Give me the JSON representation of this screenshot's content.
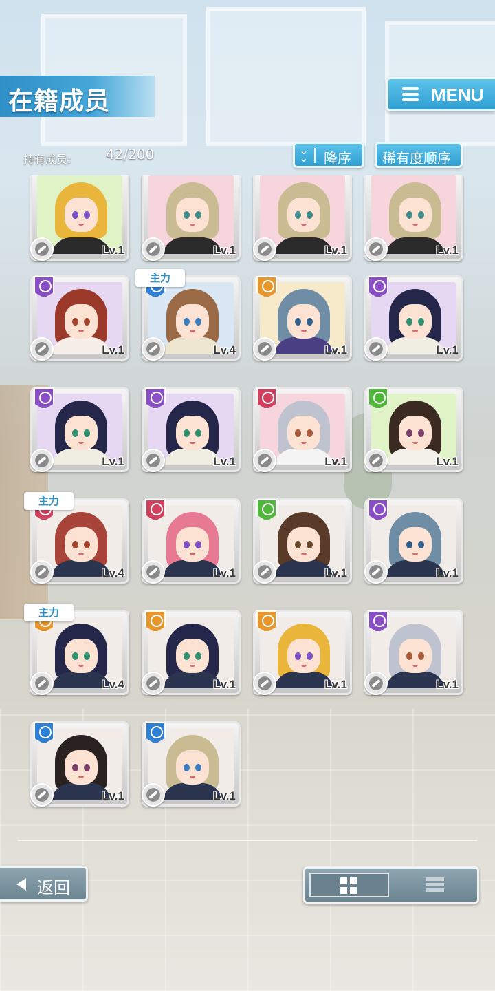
{
  "header": {
    "title": "在籍成员",
    "menu_label": "MENU"
  },
  "roster": {
    "count_label": "持有成员:",
    "count_value": "42/200"
  },
  "sort": {
    "order_label": "降序",
    "order_arrow": "⌄",
    "rarity_label": "稀有度顺序"
  },
  "badge_text": "主力",
  "cards": [
    {
      "level": "Lv.1",
      "attr": "green",
      "hair": "#e9b63b",
      "eye": "#7a4fc4",
      "body": "#2a2a2a",
      "bg": "#dff3c6",
      "badge": false,
      "top": true
    },
    {
      "level": "Lv.1",
      "attr": "red",
      "hair": "#c9bb92",
      "eye": "#3f8c8c",
      "body": "#2a2a2a",
      "bg": "#f6d6dc",
      "badge": false,
      "top": true
    },
    {
      "level": "Lv.1",
      "attr": "red",
      "hair": "#c9bb92",
      "eye": "#3f8c8c",
      "body": "#2a2a2a",
      "bg": "#f6d6dc",
      "badge": false,
      "top": true
    },
    {
      "level": "Lv.1",
      "attr": "red",
      "hair": "#c9bb92",
      "eye": "#3f8c8c",
      "body": "#2a2a2a",
      "bg": "#f6d6dc",
      "badge": false,
      "top": true
    },
    {
      "level": "Lv.1",
      "attr": "purple",
      "hair": "#9b3a2a",
      "eye": "#a4442c",
      "body": "#f5efe8",
      "bg": "#e6d8f2",
      "badge": false,
      "top": false
    },
    {
      "level": "Lv.4",
      "attr": "blue",
      "hair": "#9a6b46",
      "eye": "#3c7dbd",
      "body": "#efe6d2",
      "bg": "#d9e7f5",
      "badge": true,
      "top": false
    },
    {
      "level": "Lv.1",
      "attr": "orange",
      "hair": "#6f8ea6",
      "eye": "#2f5f8a",
      "body": "#4a3f82",
      "bg": "#f7eaca",
      "badge": false,
      "top": false
    },
    {
      "level": "Lv.1",
      "attr": "purple",
      "hair": "#24264a",
      "eye": "#2f8f6f",
      "body": "#f0ede3",
      "bg": "#e6d8f2",
      "badge": false,
      "top": false
    },
    {
      "level": "Lv.1",
      "attr": "purple",
      "hair": "#24264a",
      "eye": "#2f8f6f",
      "body": "#f0ede3",
      "bg": "#e6d8f2",
      "badge": false,
      "top": false
    },
    {
      "level": "Lv.1",
      "attr": "purple",
      "hair": "#24264a",
      "eye": "#2f8f6f",
      "body": "#f0ede3",
      "bg": "#e6d8f2",
      "badge": false,
      "top": false
    },
    {
      "level": "Lv.1",
      "attr": "red",
      "hair": "#bfc3d0",
      "eye": "#a85a3a",
      "body": "#f4f4f4",
      "bg": "#f6d6dc",
      "badge": false,
      "top": false
    },
    {
      "level": "Lv.1",
      "attr": "green",
      "hair": "#3a2a22",
      "eye": "#7a3f6a",
      "body": "#f4f1ea",
      "bg": "#dff3c6",
      "badge": false,
      "top": false
    },
    {
      "level": "Lv.4",
      "attr": "red",
      "hair": "#a8443a",
      "eye": "#a4442c",
      "body": "#2c3550",
      "bg": "#f1ece8",
      "badge": true,
      "top": false
    },
    {
      "level": "Lv.1",
      "attr": "red",
      "hair": "#e77a92",
      "eye": "#7a4fc4",
      "body": "#2c3550",
      "bg": "#f1ece8",
      "badge": false,
      "top": false
    },
    {
      "level": "Lv.1",
      "attr": "green",
      "hair": "#5a3a28",
      "eye": "#6a4a2a",
      "body": "#2c3550",
      "bg": "#f1ece8",
      "badge": false,
      "top": false
    },
    {
      "level": "Lv.1",
      "attr": "purple",
      "hair": "#6f8ea6",
      "eye": "#2f5f8a",
      "body": "#2c3550",
      "bg": "#f1ece8",
      "badge": false,
      "top": false
    },
    {
      "level": "Lv.4",
      "attr": "orange",
      "hair": "#24264a",
      "eye": "#2f8f6f",
      "body": "#2c3550",
      "bg": "#f1ece8",
      "badge": true,
      "top": false
    },
    {
      "level": "Lv.1",
      "attr": "orange",
      "hair": "#24264a",
      "eye": "#2f8f6f",
      "body": "#2c3550",
      "bg": "#f1ece8",
      "badge": false,
      "top": false
    },
    {
      "level": "Lv.1",
      "attr": "orange",
      "hair": "#e9b63b",
      "eye": "#7a4fc4",
      "body": "#2c3550",
      "bg": "#f1ece8",
      "badge": false,
      "top": false
    },
    {
      "level": "Lv.1",
      "attr": "purple",
      "hair": "#bfc3d0",
      "eye": "#a85a3a",
      "body": "#2c3550",
      "bg": "#f1ece8",
      "badge": false,
      "top": false
    },
    {
      "level": "Lv.1",
      "attr": "blue",
      "hair": "#2a2220",
      "eye": "#7a3f6a",
      "body": "#2c3550",
      "bg": "#f1ece8",
      "badge": false,
      "top": false
    },
    {
      "level": "Lv.1",
      "attr": "blue",
      "hair": "#c9bb92",
      "eye": "#3c7dbd",
      "body": "#2c3550",
      "bg": "#f1ece8",
      "badge": false,
      "top": false
    }
  ],
  "attr_colors": {
    "green": "#4fb83a",
    "red": "#d2405e",
    "purple": "#8a4fc7",
    "blue": "#2e7fd6",
    "orange": "#e8962a"
  },
  "footer": {
    "back_label": "返回",
    "view_grid_icon": "grid-icon",
    "view_list_icon": "list-icon"
  }
}
